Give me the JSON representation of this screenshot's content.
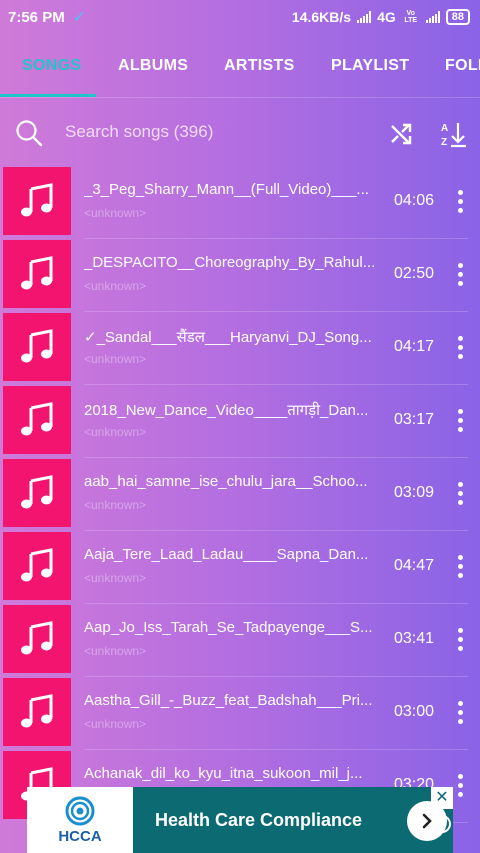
{
  "status_bar": {
    "time": "7:56 PM",
    "network_speed": "14.6KB/s",
    "network_type": "4G",
    "volte": "Vo LTE",
    "battery": "88"
  },
  "tabs": [
    {
      "label": "SONGS",
      "active": true
    },
    {
      "label": "ALBUMS",
      "active": false
    },
    {
      "label": "ARTISTS",
      "active": false
    },
    {
      "label": "PLAYLIST",
      "active": false
    },
    {
      "label": "FOLD",
      "active": false
    }
  ],
  "search": {
    "placeholder": "Search songs (396)"
  },
  "songs": [
    {
      "title": "_3_Peg_Sharry_Mann__(Full_Video)___...",
      "artist": "<unknown>",
      "duration": "04:06"
    },
    {
      "title": "_DESPACITO__Choreography_By_Rahul...",
      "artist": "<unknown>",
      "duration": "02:50"
    },
    {
      "title": "✓_Sandal___सैंडल___Haryanvi_DJ_Song...",
      "artist": "<unknown>",
      "duration": "04:17"
    },
    {
      "title": "2018_New_Dance_Video____तागड़ी_Dan...",
      "artist": "<unknown>",
      "duration": "03:17"
    },
    {
      "title": "aab_hai_samne_ise_chulu_jara__Schoo...",
      "artist": "<unknown>",
      "duration": "03:09"
    },
    {
      "title": "Aaja_Tere_Laad_Ladau____Sapna_Dan...",
      "artist": "<unknown>",
      "duration": "04:47"
    },
    {
      "title": "Aap_Jo_Iss_Tarah_Se_Tadpayenge___S...",
      "artist": "<unknown>",
      "duration": "03:41"
    },
    {
      "title": "Aastha_Gill_-_Buzz_feat_Badshah___Pri...",
      "artist": "<unknown>",
      "duration": "03:00"
    },
    {
      "title": "Achanak_dil_ko_kyu_itna_sukoon_mil_j...",
      "artist": "<unknown>",
      "duration": "03:20"
    }
  ],
  "ad": {
    "logo_text": "HCCA",
    "title": "Health Care Compliance",
    "close": "✕",
    "info": "i"
  },
  "colors": {
    "accent": "#20c5c9",
    "thumb": "#f2146e",
    "ad_bg": "#0b6a72"
  }
}
